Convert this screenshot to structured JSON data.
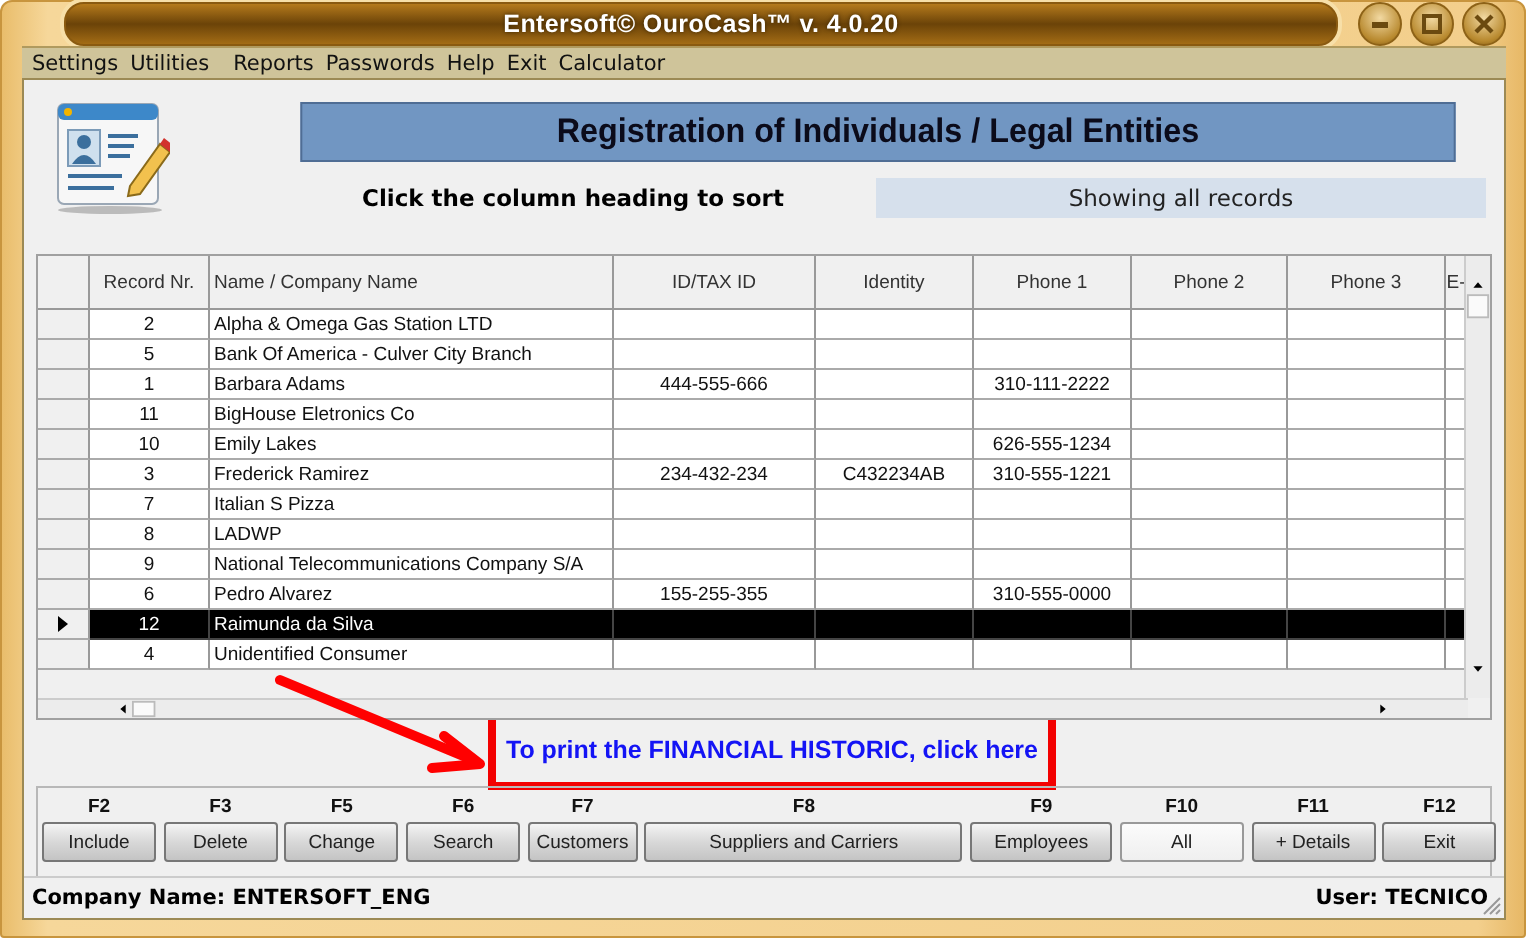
{
  "window": {
    "title": "Entersoft© OuroCash™ v. 4.0.20"
  },
  "menu": [
    "Settings",
    "Utilities",
    "Reports",
    "Passwords",
    "Help",
    "Exit",
    "Calculator"
  ],
  "header": {
    "title": "Registration of Individuals / Legal Entities",
    "sort_hint": "Click the column heading to sort",
    "filter_status": "Showing all records"
  },
  "table": {
    "columns": [
      "Record Nr.",
      "Name / Company Name",
      "ID/TAX ID",
      "Identity",
      "Phone 1",
      "Phone 2",
      "Phone 3",
      "E-"
    ],
    "rows": [
      {
        "selected": false,
        "cells": [
          "2",
          "Alpha & Omega Gas Station LTD",
          "",
          "",
          "",
          "",
          "",
          ""
        ]
      },
      {
        "selected": false,
        "cells": [
          "5",
          "Bank Of America - Culver City Branch",
          "",
          "",
          "",
          "",
          "",
          ""
        ]
      },
      {
        "selected": false,
        "cells": [
          "1",
          "Barbara Adams",
          "444-555-666",
          "",
          "310-111-2222",
          "",
          "",
          ""
        ]
      },
      {
        "selected": false,
        "cells": [
          "11",
          "BigHouse Eletronics Co",
          "",
          "",
          "",
          "",
          "",
          ""
        ]
      },
      {
        "selected": false,
        "cells": [
          "10",
          "Emily Lakes",
          "",
          "",
          "626-555-1234",
          "",
          "",
          ""
        ]
      },
      {
        "selected": false,
        "cells": [
          "3",
          "Frederick Ramirez",
          "234-432-234",
          "C432234AB",
          "310-555-1221",
          "",
          "",
          ""
        ]
      },
      {
        "selected": false,
        "cells": [
          "7",
          "Italian S Pizza",
          "",
          "",
          "",
          "",
          "",
          ""
        ]
      },
      {
        "selected": false,
        "cells": [
          "8",
          "LADWP",
          "",
          "",
          "",
          "",
          "",
          ""
        ]
      },
      {
        "selected": false,
        "cells": [
          "9",
          "National Telecommunications Company S/A",
          "",
          "",
          "",
          "",
          "",
          ""
        ]
      },
      {
        "selected": false,
        "cells": [
          "6",
          "Pedro Alvarez",
          "155-255-355",
          "",
          "310-555-0000",
          "",
          "",
          ""
        ]
      },
      {
        "selected": true,
        "cells": [
          "12",
          "Raimunda da Silva",
          "",
          "",
          "",
          "",
          "",
          ""
        ]
      },
      {
        "selected": false,
        "cells": [
          "4",
          "Unidentified Consumer",
          "",
          "",
          "",
          "",
          "",
          ""
        ]
      }
    ]
  },
  "link": "To print the FINANCIAL HISTORIC, click here",
  "function_keys": [
    {
      "key": "F2",
      "label": "Include",
      "selected": false
    },
    {
      "key": "F3",
      "label": "Delete",
      "selected": false
    },
    {
      "key": "F5",
      "label": "Change",
      "selected": false
    },
    {
      "key": "F6",
      "label": "Search",
      "selected": false
    },
    {
      "key": "F7",
      "label": "Customers",
      "selected": false
    },
    {
      "key": "F8",
      "label": "Suppliers and Carriers",
      "selected": false
    },
    {
      "key": "F9",
      "label": "Employees",
      "selected": false
    },
    {
      "key": "F10",
      "label": "All",
      "selected": true
    },
    {
      "key": "F11",
      "label": "+ Details",
      "selected": false
    },
    {
      "key": "F12",
      "label": "Exit",
      "selected": false
    }
  ],
  "status_bar": {
    "company": "Company Name: ENTERSOFT_ENG",
    "user": "User: TECNICO"
  }
}
